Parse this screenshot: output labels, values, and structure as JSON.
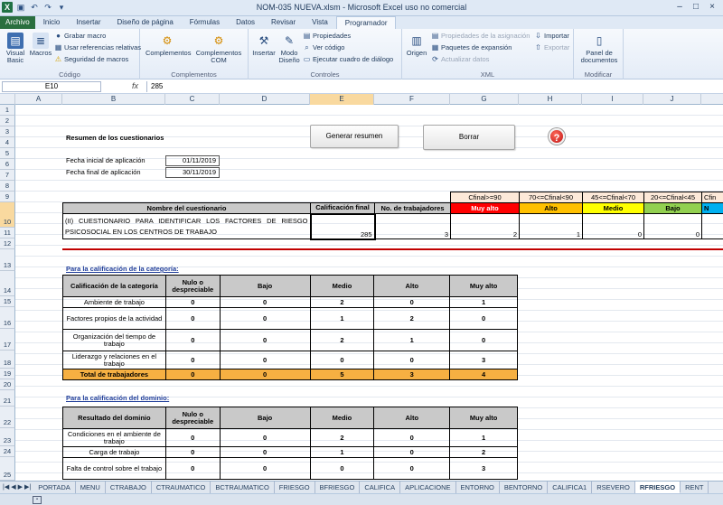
{
  "window": {
    "title": "NOM-035 NUEVA.xlsm  -  Microsoft Excel uso no comercial"
  },
  "ribbon_tabs": [
    "Archivo",
    "Inicio",
    "Insertar",
    "Diseño de página",
    "Fórmulas",
    "Datos",
    "Revisar",
    "Vista",
    "Programador"
  ],
  "ribbon": {
    "codigo": {
      "label": "Código",
      "visual_basic": "Visual Basic",
      "macros": "Macros",
      "grabar_macro": "Grabar macro",
      "usar_referencias": "Usar referencias relativas",
      "seguridad": "Seguridad de macros"
    },
    "complementos": {
      "label": "Complementos",
      "complementos": "Complementos",
      "complementos_com": "Complementos COM"
    },
    "controles": {
      "label": "Controles",
      "insertar": "Insertar",
      "modo_diseno": "Modo Diseño",
      "propiedades": "Propiedades",
      "ver_codigo": "Ver código",
      "ejecutar_cuadro": "Ejecutar cuadro de diálogo"
    },
    "xml": {
      "label": "XML",
      "origen": "Origen",
      "propiedades_asignacion": "Propiedades de la asignación",
      "paquetes": "Paquetes de expansión",
      "actualizar": "Actualizar datos",
      "importar": "Importar",
      "exportar": "Exportar"
    },
    "modificar": {
      "label": "Modificar",
      "panel": "Panel de documentos"
    }
  },
  "formula_bar": {
    "name_box": "E10",
    "fx": "fx",
    "value": "285"
  },
  "columns": [
    "A",
    "B",
    "C",
    "D",
    "E",
    "F",
    "G",
    "H",
    "I",
    "J"
  ],
  "rows": [
    "1",
    "2",
    "3",
    "4",
    "5",
    "6",
    "7",
    "8",
    "9",
    "10",
    "11",
    "12",
    "13",
    "14",
    "15",
    "16",
    "17",
    "18",
    "19",
    "20",
    "21",
    "22",
    "23",
    "24",
    "25"
  ],
  "sheet": {
    "resumen_title": "Resumen de los cuestionarios",
    "fecha_inicial_label": "Fecha inicial de aplicación",
    "fecha_inicial": "01/11/2019",
    "fecha_final_label": "Fecha final de aplicación",
    "fecha_final": "30/11/2019",
    "btn_generar": "Generar resumen",
    "btn_borrar": "Borrar",
    "help_icon": "?",
    "ranges": [
      "Cfinal>=90",
      "70<=Cfinal<90",
      "45<=Cfinal<70",
      "20<=Cfinal<45",
      "Cfin"
    ],
    "summary_headers": [
      "Nombre del cuestionario",
      "Calificación final",
      "No. de trabajadores"
    ],
    "levels": [
      "Muy alto",
      "Alto",
      "Medio",
      "Bajo",
      "N"
    ],
    "level_colors": [
      "#ff0000",
      "#ffc000",
      "#ffff00",
      "#92d050",
      "#00b0f0"
    ],
    "summary_row": {
      "name": "(II) CUESTIONARIO PARA IDENTIFICAR LOS FACTORES DE RIESGO PSICOSOCIAL EN LOS CENTROS DE TRABAJO",
      "calificacion": "285",
      "trabajadores": "3",
      "muy_alto": "2",
      "alto": "1",
      "medio": "0",
      "bajo": "0"
    },
    "categoria": {
      "section": "Para la calificación de la categoría:",
      "headers": [
        "Calificación de la categoría",
        "Nulo o despreciable",
        "Bajo",
        "Medio",
        "Alto",
        "Muy alto"
      ],
      "rows": [
        {
          "label": "Ambiente de trabajo",
          "values": [
            "0",
            "0",
            "2",
            "0",
            "1"
          ]
        },
        {
          "label": "Factores propios de la actividad",
          "values": [
            "0",
            "0",
            "1",
            "2",
            "0"
          ]
        },
        {
          "label": "Organización del tiempo de trabajo",
          "values": [
            "0",
            "0",
            "2",
            "1",
            "0"
          ]
        },
        {
          "label": "Liderazgo y relaciones en el trabajo",
          "values": [
            "0",
            "0",
            "0",
            "0",
            "3"
          ]
        }
      ],
      "total": {
        "label": "Total de trabajadores",
        "values": [
          "0",
          "0",
          "5",
          "3",
          "4"
        ]
      }
    },
    "dominio": {
      "section": "Para la calificación del dominio:",
      "headers": [
        "Resultado del dominio",
        "Nulo o despreciable",
        "Bajo",
        "Medio",
        "Alto",
        "Muy alto"
      ],
      "rows": [
        {
          "label": "Condiciones en el ambiente de trabajo",
          "values": [
            "0",
            "0",
            "2",
            "0",
            "1"
          ]
        },
        {
          "label": "Carga de trabajo",
          "values": [
            "0",
            "0",
            "1",
            "0",
            "2"
          ]
        },
        {
          "label": "Falta de control sobre el trabajo",
          "values": [
            "0",
            "0",
            "0",
            "0",
            "3"
          ]
        }
      ]
    }
  },
  "sheet_tabs": [
    "PORTADA",
    "MENU",
    "CTRABAJO",
    "CTRAUMATICO",
    "BCTRAUMATICO",
    "FRIESGO",
    "BFRIESGO",
    "CALIFICA",
    "APLICACIONE",
    "ENTORNO",
    "BENTORNO",
    "CALIFICA1",
    "RSEVERO",
    "RFRIESGO",
    "RENT"
  ],
  "active_sheet": "RFRIESGO"
}
